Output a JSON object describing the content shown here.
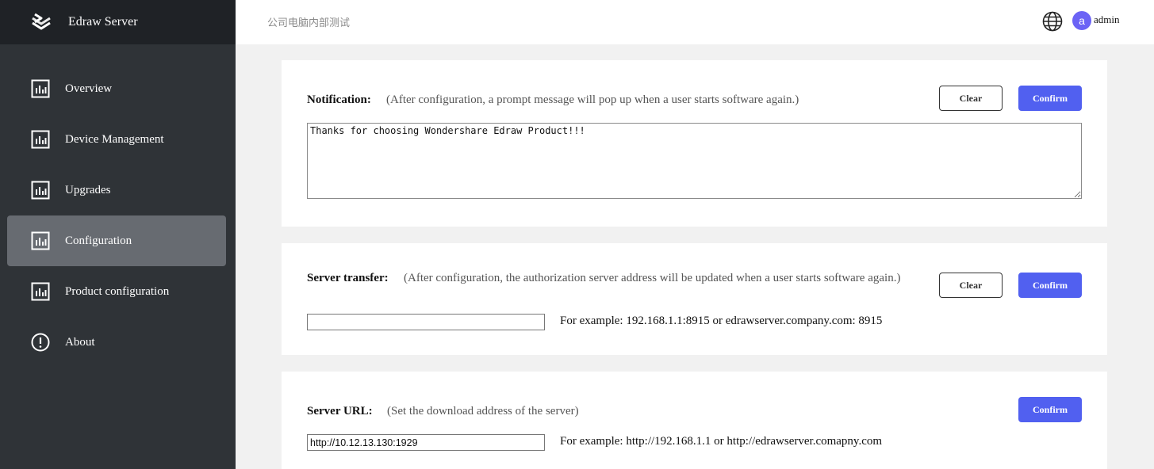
{
  "brand": {
    "name": "Edraw Server"
  },
  "header": {
    "title": "公司电脑内部测试",
    "username": "admin",
    "avatar_letter": "a"
  },
  "sidebar": {
    "items": [
      {
        "label": "Overview",
        "icon": "bar-chart-icon"
      },
      {
        "label": "Device Management",
        "icon": "bar-chart-icon"
      },
      {
        "label": "Upgrades",
        "icon": "bar-chart-icon"
      },
      {
        "label": "Configuration",
        "icon": "bar-chart-icon",
        "active": true
      },
      {
        "label": "Product configuration",
        "icon": "bar-chart-icon"
      },
      {
        "label": "About",
        "icon": "info-icon"
      }
    ]
  },
  "notification": {
    "label": "Notification:",
    "description": "(After configuration, a prompt message will pop up when a user starts software again.)",
    "value": "Thanks for choosing Wondershare Edraw Product!!!",
    "clear_label": "Clear",
    "confirm_label": "Confirm"
  },
  "server_transfer": {
    "label": "Server transfer:",
    "description": "(After configuration, the authorization server address will be updated when a user starts software again.)",
    "value": "",
    "example": "For example: 192.168.1.1:8915 or edrawserver.company.com: 8915",
    "clear_label": "Clear",
    "confirm_label": "Confirm"
  },
  "server_url": {
    "label": "Server URL:",
    "description": "(Set the download address of the server)",
    "value": "http://10.12.13.130:1929",
    "example": "For example: http://192.168.1.1 or http://edrawserver.comapny.com",
    "confirm_label": "Confirm"
  },
  "colors": {
    "accent": "#5160f0",
    "sidebar": "#2f3337",
    "sidebar_active": "#676b71",
    "avatar": "#6b63f5"
  }
}
